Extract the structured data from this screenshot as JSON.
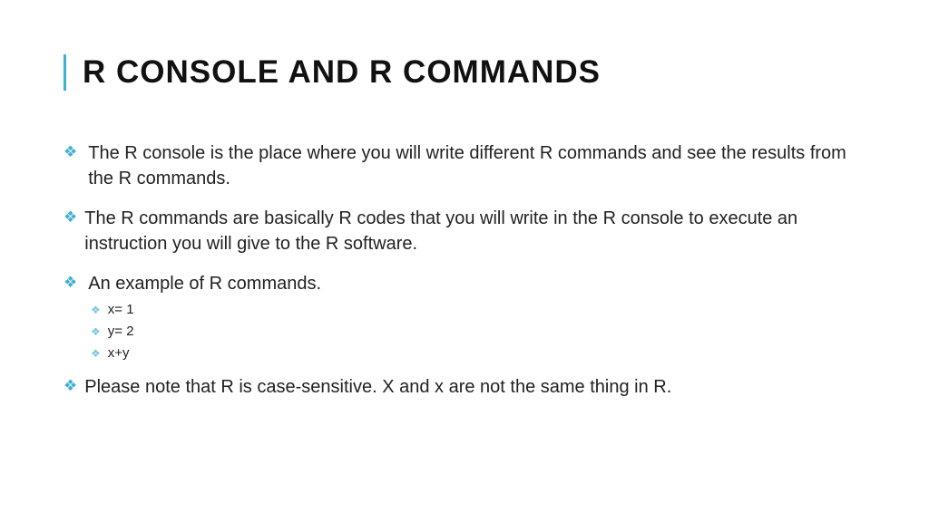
{
  "title": "R CONSOLE AND R COMMANDS",
  "bullets": [
    "The R console is the place where you will write different R commands and see the results from the R commands.",
    "The R commands are basically R codes that you will write in the R console to execute an instruction you will give to the R software.",
    "An example of R commands.",
    "Please note that R is case-sensitive. X and x are not the same thing in R."
  ],
  "example_code": [
    "x= 1",
    "y= 2",
    "x+y"
  ]
}
